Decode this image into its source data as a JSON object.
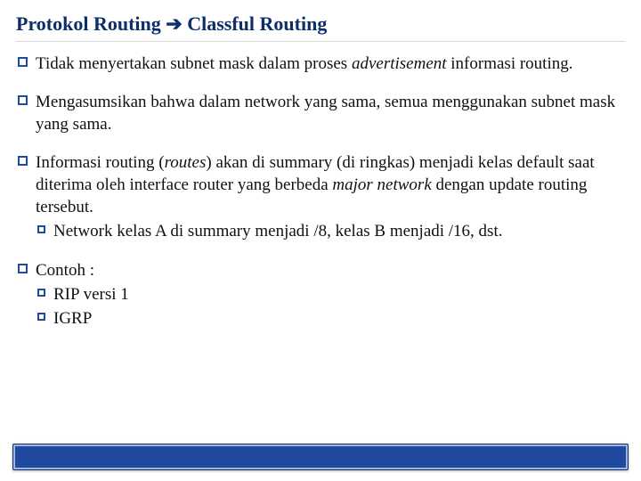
{
  "title": {
    "part1": "Protokol Routing ",
    "arrow": "➔",
    "part2": " Classful Routing"
  },
  "bullets": [
    {
      "pre": "Tidak menyertakan subnet mask dalam proses ",
      "em": "advertisement",
      "post": " informasi routing."
    },
    {
      "pre": "Mengasumsikan bahwa dalam network yang sama, semua menggunakan subnet mask yang sama.",
      "em": "",
      "post": ""
    },
    {
      "pre": "Informasi routing (",
      "em": "routes",
      "post": ")  akan di summary (di ringkas) menjadi kelas default saat diterima oleh interface router yang berbeda ",
      "em2": "major network",
      "post2": " dengan update routing tersebut.",
      "sub": [
        "Network kelas A di summary menjadi /8, kelas B menjadi /16, dst."
      ]
    },
    {
      "pre": "Contoh :",
      "em": "",
      "post": "",
      "sub": [
        "RIP versi 1",
        "IGRP"
      ]
    }
  ]
}
